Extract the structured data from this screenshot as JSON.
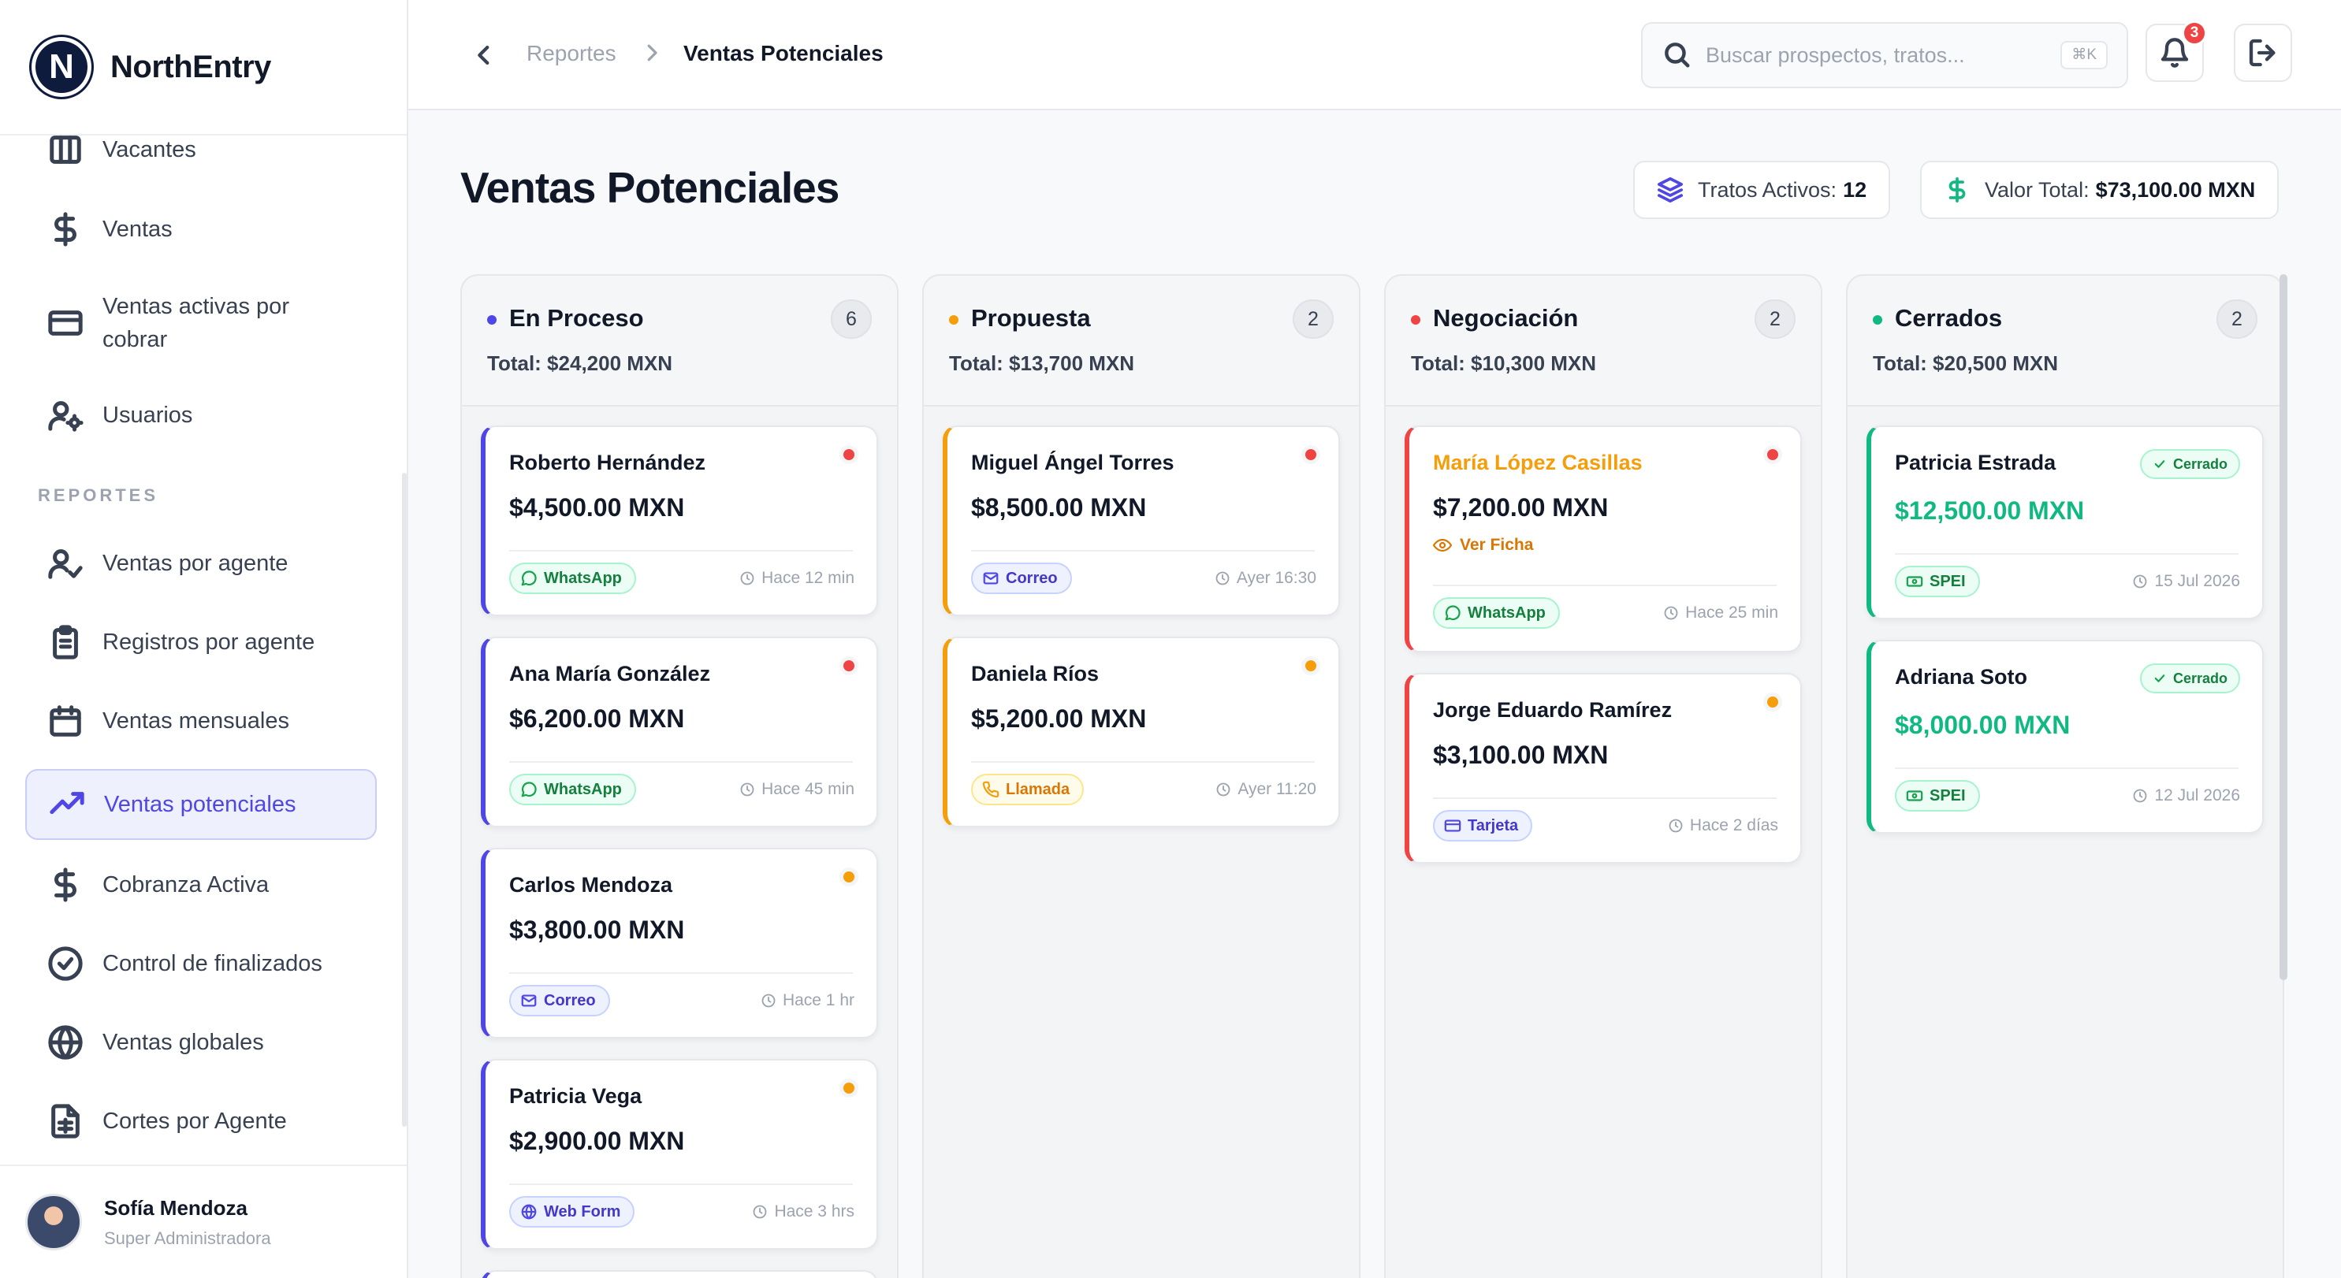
{
  "app": {
    "name": "NorthEntry",
    "logo_letter": "N"
  },
  "sidebar": {
    "items_top": [
      {
        "label": "Vacantes",
        "icon": "columns-icon"
      },
      {
        "label": "Ventas",
        "icon": "dollar-icon"
      },
      {
        "label": "Ventas activas por cobrar",
        "line1": "Ventas activas por",
        "line2": "cobrar",
        "icon": "credit-card-icon"
      },
      {
        "label": "Usuarios",
        "icon": "users-gear-icon"
      }
    ],
    "section_label": "REPORTES",
    "items_reports": [
      {
        "label": "Ventas por agente",
        "icon": "user-check-icon"
      },
      {
        "label": "Registros por agente",
        "icon": "clipboard-icon"
      },
      {
        "label": "Ventas mensuales",
        "icon": "calendar-icon"
      },
      {
        "label": "Ventas potenciales",
        "icon": "trending-up-icon",
        "active": true
      },
      {
        "label": "Cobranza Activa",
        "icon": "dollar-icon"
      },
      {
        "label": "Control de finalizados",
        "icon": "check-circle-icon"
      },
      {
        "label": "Ventas globales",
        "icon": "globe-icon"
      },
      {
        "label": "Cortes por Agente",
        "icon": "file-sheet-icon"
      }
    ],
    "user": {
      "name": "Sofía Mendoza",
      "role": "Super Administradora"
    }
  },
  "header": {
    "breadcrumb": [
      "Reportes",
      "Ventas Potenciales"
    ],
    "search": {
      "placeholder": "Buscar prospectos, tratos...",
      "shortcut": "⌘K"
    },
    "notifications_count": "3"
  },
  "page": {
    "title": "Ventas Potenciales",
    "stats": {
      "active_label": "Tratos Activos:",
      "active_value": "12",
      "total_label": "Valor Total:",
      "total_value": "$73,100.00 MXN"
    }
  },
  "colors": {
    "accent": "#4f46e5",
    "en_proceso": "#4f46e5",
    "propuesta": "#f59e0b",
    "negociacion": "#ef4444",
    "cerrados": "#10b981"
  },
  "columns": [
    {
      "title": "En Proceso",
      "total": "Total: $24,200 MXN",
      "count": "6",
      "cards": [
        {
          "name": "Roberto Hernández",
          "amount": "$4,500.00 MXN",
          "channel": "WhatsApp",
          "time": "Hace 12 min",
          "priority": "high"
        },
        {
          "name": "Ana María González",
          "amount": "$6,200.00 MXN",
          "channel": "WhatsApp",
          "time": "Hace 45 min",
          "priority": "high"
        },
        {
          "name": "Carlos Mendoza",
          "amount": "$3,800.00 MXN",
          "channel": "Correo",
          "time": "Hace 1 hr",
          "priority": "medium"
        },
        {
          "name": "Patricia Vega",
          "amount": "$2,900.00 MXN",
          "channel": "Web Form",
          "time": "Hace 3 hrs",
          "priority": "medium"
        }
      ]
    },
    {
      "title": "Propuesta",
      "total": "Total: $13,700 MXN",
      "count": "2",
      "cards": [
        {
          "name": "Miguel Ángel Torres",
          "amount": "$8,500.00 MXN",
          "channel": "Correo",
          "time": "Ayer 16:30",
          "priority": "high"
        },
        {
          "name": "Daniela Ríos",
          "amount": "$5,200.00 MXN",
          "channel": "Llamada",
          "time": "Ayer 11:20",
          "priority": "medium"
        }
      ]
    },
    {
      "title": "Negociación",
      "total": "Total: $10,300 MXN",
      "count": "2",
      "cards": [
        {
          "name": "María López Casillas",
          "amount": "$7,200.00 MXN",
          "link": "Ver Ficha",
          "channel": "WhatsApp",
          "time": "Hace 25 min",
          "priority": "high"
        },
        {
          "name": "Jorge Eduardo Ramírez",
          "amount": "$3,100.00 MXN",
          "channel": "Tarjeta",
          "time": "Hace 2 días",
          "priority": "medium"
        }
      ]
    },
    {
      "title": "Cerrados",
      "total": "Total: $20,500 MXN",
      "count": "2",
      "cards": [
        {
          "name": "Patricia Estrada",
          "amount": "$12,500.00 MXN",
          "badge": "Cerrado",
          "channel": "SPEI",
          "time": "15 Jul 2026"
        },
        {
          "name": "Adriana Soto",
          "amount": "$8,000.00 MXN",
          "badge": "Cerrado",
          "channel": "SPEI",
          "time": "12 Jul 2026"
        }
      ]
    }
  ]
}
